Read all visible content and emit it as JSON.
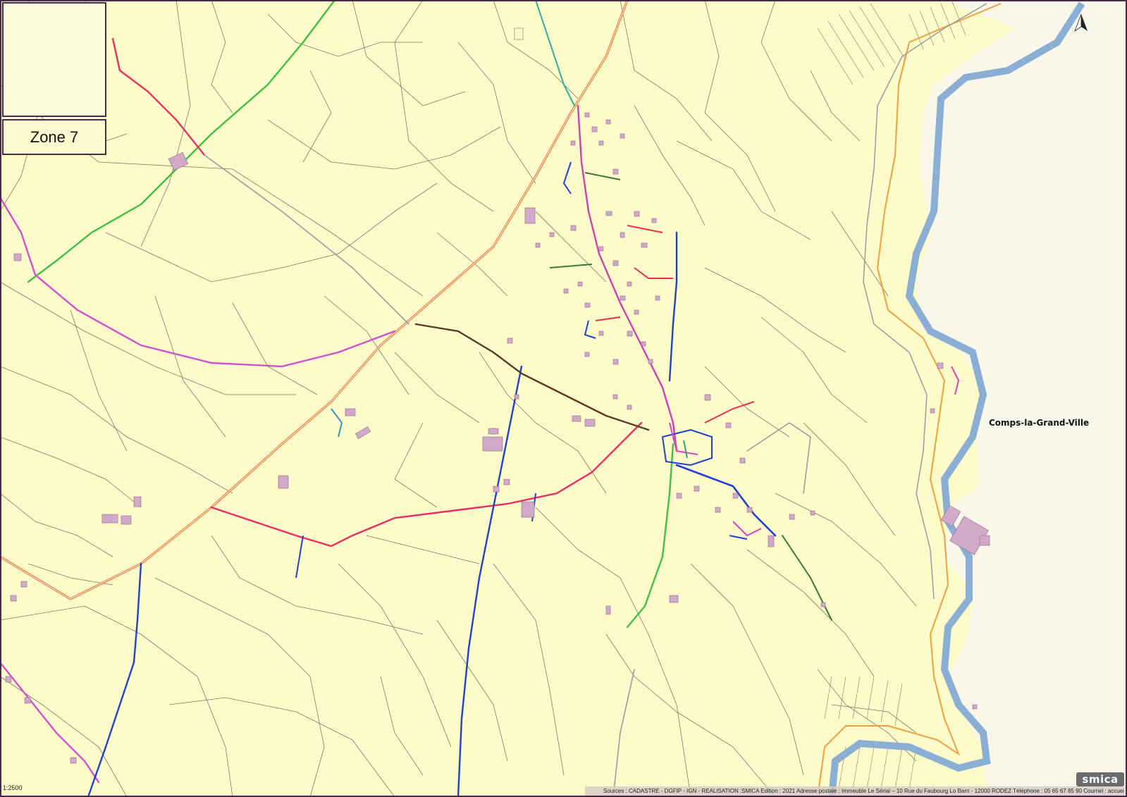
{
  "map": {
    "zone_label": "Zone 7",
    "place_name": "Comps-la-Grand-Ville",
    "scale": "1:2500",
    "sources": "Sources : CADASTRE - DGFIP - IGN - REALISATION :SMICA   Edition : 2021 Adresse postale : Immeuble Le Sérial – 10 Rue du Faubourg Lo Barri - 12000 RODEZ Téléphone : 05 65 67 85 90 Courriel : accueil@smica.fr",
    "logo_text": "smica",
    "north_icon": "north-arrow-icon"
  },
  "colors": {
    "background": "#fdfbc9",
    "parcel_line": "#7a7a6a",
    "river": "#8aaed4",
    "building": "#d2a9c8",
    "road_orange": "#f07a3a",
    "road_magenta": "#e040c0",
    "road_blue": "#2040d0",
    "road_green": "#40c040",
    "road_red": "#e83050",
    "road_brown": "#5a3a2a"
  }
}
